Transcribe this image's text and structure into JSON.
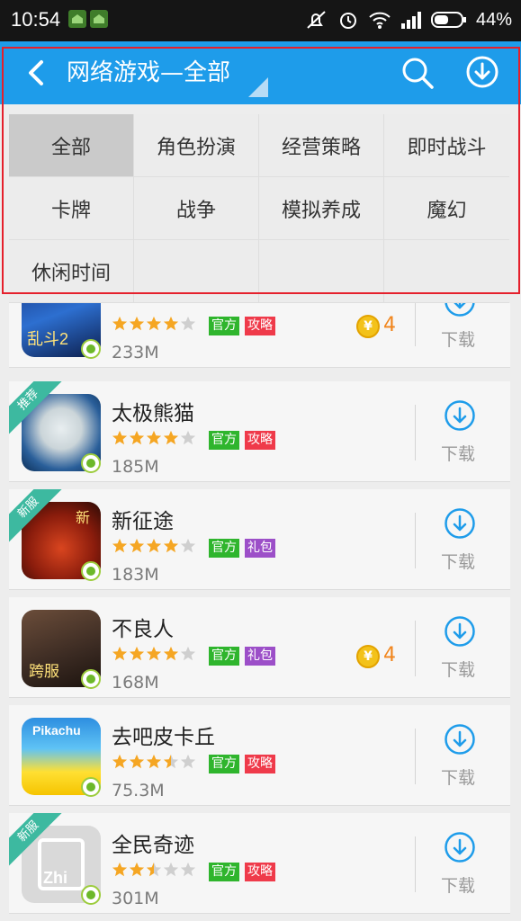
{
  "status_bar": {
    "time": "10:54",
    "battery": "44%",
    "icons": [
      "app-notification-icon",
      "app-notification-icon",
      "mute-icon",
      "alarm-icon",
      "wifi-icon",
      "signal-icon",
      "battery-icon"
    ]
  },
  "header": {
    "title": "网络游戏—全部",
    "back_icon": "back-arrow-icon",
    "search_icon": "search-icon",
    "download_icon": "download-icon",
    "color": "#1e9cea"
  },
  "categories": [
    {
      "label": "全部",
      "selected": true
    },
    {
      "label": "角色扮演"
    },
    {
      "label": "经营策略"
    },
    {
      "label": "即时战斗"
    },
    {
      "label": "卡牌"
    },
    {
      "label": "战争"
    },
    {
      "label": "模拟养成"
    },
    {
      "label": "魔幻"
    },
    {
      "label": "休闲时间"
    }
  ],
  "apps": [
    {
      "name": "",
      "rating": 4,
      "tags": [
        "官方",
        "攻略"
      ],
      "size": "233M",
      "coins": "4",
      "download": "下载",
      "icon_text": "乱斗2"
    },
    {
      "name": "太极熊猫",
      "rating": 4,
      "tags": [
        "官方",
        "攻略"
      ],
      "size": "185M",
      "download": "下载",
      "ribbon": "推荐"
    },
    {
      "name": "新征途",
      "rating": 4,
      "tags": [
        "官方",
        "礼包"
      ],
      "size": "183M",
      "download": "下载",
      "ribbon": "新服",
      "icon_text": "新"
    },
    {
      "name": "不良人",
      "rating": 4,
      "tags": [
        "官方",
        "礼包"
      ],
      "size": "168M",
      "coins": "4",
      "download": "下载",
      "icon_text": "跨服"
    },
    {
      "name": "去吧皮卡丘",
      "rating": 3.5,
      "tags": [
        "官方",
        "攻略"
      ],
      "size": "75.3M",
      "download": "下载",
      "icon_text": "Pikachu"
    },
    {
      "name": "全民奇迹",
      "rating": 2.5,
      "tags": [
        "官方",
        "攻略"
      ],
      "size": "301M",
      "download": "下载",
      "ribbon": "新服",
      "icon_text": "Zhi"
    }
  ],
  "colors": {
    "accent": "#1e9cea",
    "star": "#f5a623",
    "tag_official": "#2fb52d",
    "tag_guide": "#ef3a4a",
    "tag_gift": "#9c4fc8",
    "ribbon": "#3db9a0",
    "highlight_frame": "#e5202c"
  }
}
